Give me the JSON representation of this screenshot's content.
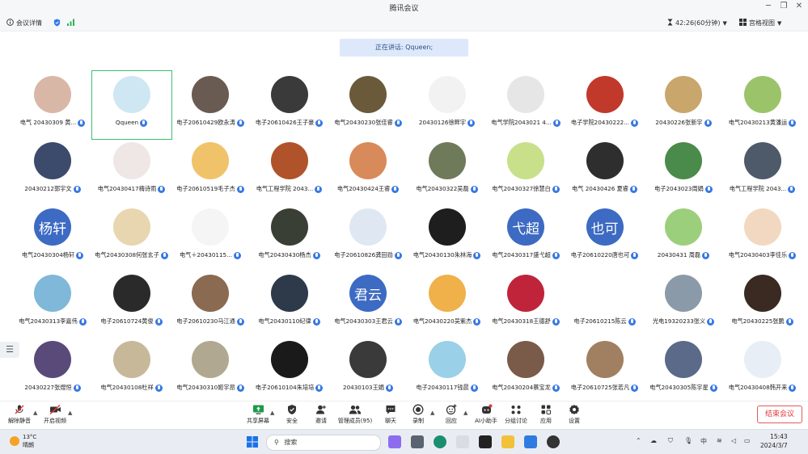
{
  "window": {
    "title": "腾讯会议",
    "controls": [
      "─",
      "❐",
      "✕"
    ]
  },
  "subbar": {
    "meeting_details": "会议详情",
    "timer": "42:26(60分钟)",
    "view_mode": "宫格视图"
  },
  "speaking_banner": "正在讲话: Qqueen;",
  "participants": [
    {
      "name": "电气 20430309 黄...",
      "avatar": "photo",
      "avatar_color": "#d9b7a7"
    },
    {
      "name": "Qqueen",
      "avatar": "photo",
      "avatar_color": "#cfe7f3",
      "active": true
    },
    {
      "name": "电子20610429欧永涛",
      "avatar": "photo",
      "avatar_color": "#6a5b52"
    },
    {
      "name": "电子20610426王子豪",
      "avatar": "photo",
      "avatar_color": "#3a3a3a"
    },
    {
      "name": "电气20430230张佳睿",
      "avatar": "photo",
      "avatar_color": "#6b5a3a"
    },
    {
      "name": "20430126徐畔宇",
      "avatar": "photo",
      "avatar_color": "#f2f2f2"
    },
    {
      "name": "电气学院2043021 4...",
      "avatar": "photo",
      "avatar_color": "#e6e6e6"
    },
    {
      "name": "电子学院20430222...",
      "avatar": "photo",
      "avatar_color": "#c0392b"
    },
    {
      "name": "20430226张新宇",
      "avatar": "photo",
      "avatar_color": "#c9a66b"
    },
    {
      "name": "电气20430213黄潘运",
      "avatar": "photo",
      "avatar_color": "#9bc46a"
    },
    {
      "name": "20430212郭宇文",
      "avatar": "photo",
      "avatar_color": "#3c4a6b"
    },
    {
      "name": "电气20430417梅诗雨",
      "avatar": "photo",
      "avatar_color": "#efe6e6"
    },
    {
      "name": "电子20610519毛子杰",
      "avatar": "photo",
      "avatar_color": "#f0c36a"
    },
    {
      "name": "电气工程学院 2043...",
      "avatar": "photo",
      "avatar_color": "#b0532a"
    },
    {
      "name": "电气20430424王睿",
      "avatar": "photo",
      "avatar_color": "#d98a5a"
    },
    {
      "name": "电气20430322吴磊",
      "avatar": "photo",
      "avatar_color": "#6e7a5a"
    },
    {
      "name": "电气20430327徐慧白",
      "avatar": "photo",
      "avatar_color": "#c8e08a"
    },
    {
      "name": "电气 20430426 夏睿",
      "avatar": "photo",
      "avatar_color": "#2e2e2e"
    },
    {
      "name": "电子2043023周娟",
      "avatar": "photo",
      "avatar_color": "#4a8a4a"
    },
    {
      "name": "电气工程学院 2043...",
      "avatar": "photo",
      "avatar_color": "#4e5a6a"
    },
    {
      "name": "电气20430304杨轩",
      "avatar": "text",
      "avatar_text": "杨轩"
    },
    {
      "name": "电气20430308何张玄子",
      "avatar": "photo",
      "avatar_color": "#e8d6b0"
    },
    {
      "name": "电气＋20430115...",
      "avatar": "photo",
      "avatar_color": "#f5f5f5"
    },
    {
      "name": "电气20430430杨杰",
      "avatar": "photo",
      "avatar_color": "#3a3f36"
    },
    {
      "name": "电子20610826龚田勋",
      "avatar": "photo",
      "avatar_color": "#dfe8f2"
    },
    {
      "name": "电气20430130朱林海",
      "avatar": "photo",
      "avatar_color": "#1e1e1e"
    },
    {
      "name": "电气20430317盛弋超",
      "avatar": "text",
      "avatar_text": "弋超"
    },
    {
      "name": "电子20610220唐也可",
      "avatar": "text",
      "avatar_text": "也可"
    },
    {
      "name": "20430431 周磊",
      "avatar": "photo",
      "avatar_color": "#9ccf7c"
    },
    {
      "name": "电气20430403李佳乐",
      "avatar": "photo",
      "avatar_color": "#f2d8c0"
    },
    {
      "name": "电气20430313李嘉伟",
      "avatar": "photo",
      "avatar_color": "#7fb8d8"
    },
    {
      "name": "电子20610724黄俊",
      "avatar": "photo",
      "avatar_color": "#2a2a2a"
    },
    {
      "name": "电子20610230马江通",
      "avatar": "photo",
      "avatar_color": "#8a6a50"
    },
    {
      "name": "电气20430110纪律",
      "avatar": "photo",
      "avatar_color": "#2e3a4a"
    },
    {
      "name": "电气20430303王君云",
      "avatar": "text",
      "avatar_text": "君云"
    },
    {
      "name": "电气20430220吴紫杰",
      "avatar": "photo",
      "avatar_color": "#f0b04a"
    },
    {
      "name": "电气20430318王德舒",
      "avatar": "photo",
      "avatar_color": "#c0243a"
    },
    {
      "name": "电子20610215陈云",
      "avatar": "photo",
      "avatar_color": "#ffffff"
    },
    {
      "name": "光电19320233张义",
      "avatar": "photo",
      "avatar_color": "#8a9aa8"
    },
    {
      "name": "电气20430225张鹏",
      "avatar": "photo",
      "avatar_color": "#3a2a22"
    },
    {
      "name": "20430227张煜恒",
      "avatar": "photo",
      "avatar_color": "#5a4a7a"
    },
    {
      "name": "电气20430108杜祥",
      "avatar": "photo",
      "avatar_color": "#c8b89a"
    },
    {
      "name": "电气20430310姬宇昂",
      "avatar": "photo",
      "avatar_color": "#b0a890"
    },
    {
      "name": "电子20610104朱培培",
      "avatar": "photo",
      "avatar_color": "#1a1a1a"
    },
    {
      "name": "20430103王娟",
      "avatar": "photo",
      "avatar_color": "#3a3a3a"
    },
    {
      "name": "电子20430117钱晨",
      "avatar": "photo",
      "avatar_color": "#9ad0e8"
    },
    {
      "name": "电气20430204蔡宝龙",
      "avatar": "photo",
      "avatar_color": "#7a5a48"
    },
    {
      "name": "电子20610725张若凡",
      "avatar": "photo",
      "avatar_color": "#a08060"
    },
    {
      "name": "电气20430305陈宇星",
      "avatar": "photo",
      "avatar_color": "#5a6a88"
    },
    {
      "name": "电气20430408韩开来",
      "avatar": "photo",
      "avatar_color": "#e8eef5"
    }
  ],
  "toolbar": {
    "unmute": "解除静音",
    "start_video": "开启视频",
    "share_screen": "共享屏幕",
    "security": "安全",
    "invite": "邀请",
    "manage_members": "管理成员(95)",
    "chat": "聊天",
    "record": "录制",
    "reactions": "回应",
    "ai_assistant": "AI小助手",
    "breakout": "分组讨论",
    "apps": "应用",
    "settings": "设置",
    "end_meeting": "结束会议"
  },
  "taskbar": {
    "temperature": "13°C",
    "weather": "晴朗",
    "search_placeholder": "搜索",
    "ime": "中",
    "time": "15:43",
    "date": "2024/3/7"
  },
  "colors": {
    "accent_blue": "#3778e5",
    "active_border": "#3bbf6e",
    "end_red": "#e03a3a"
  }
}
